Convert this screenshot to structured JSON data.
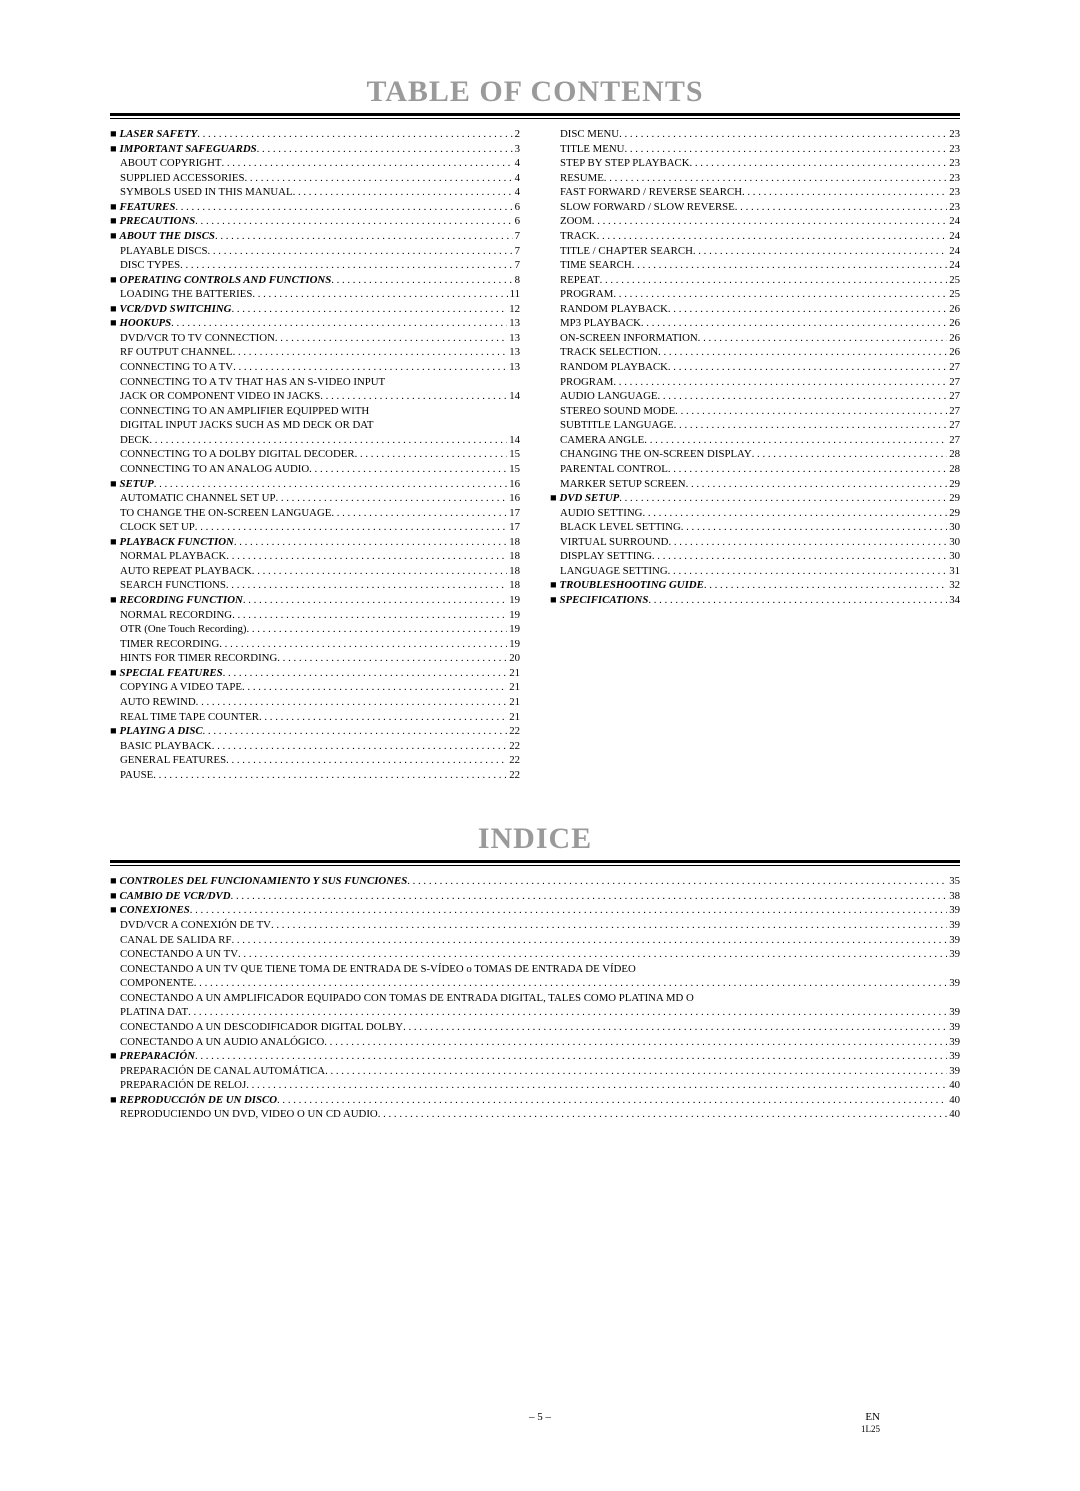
{
  "headings": {
    "toc": "TABLE OF CONTENTS",
    "indice": "INDICE"
  },
  "footer": {
    "page": "– 5 –",
    "lang": "EN",
    "code": "1L25"
  },
  "toc_left": [
    {
      "label": "LASER SAFETY",
      "page": "2",
      "bold": true,
      "indent": false
    },
    {
      "label": "IMPORTANT SAFEGUARDS",
      "page": "3",
      "bold": true,
      "indent": false
    },
    {
      "label": "ABOUT COPYRIGHT",
      "page": "4",
      "bold": false,
      "indent": true
    },
    {
      "label": "SUPPLIED ACCESSORIES",
      "page": "4",
      "bold": false,
      "indent": true
    },
    {
      "label": "SYMBOLS USED IN THIS MANUAL",
      "page": "4",
      "bold": false,
      "indent": true
    },
    {
      "label": "FEATURES",
      "page": "6",
      "bold": true,
      "indent": false
    },
    {
      "label": "PRECAUTIONS",
      "page": "6",
      "bold": true,
      "indent": false
    },
    {
      "label": "ABOUT THE DISCS",
      "page": "7",
      "bold": true,
      "indent": false
    },
    {
      "label": "PLAYABLE DISCS",
      "page": "7",
      "bold": false,
      "indent": true
    },
    {
      "label": "DISC TYPES",
      "page": "7",
      "bold": false,
      "indent": true
    },
    {
      "label": "OPERATING CONTROLS AND FUNCTIONS",
      "page": "8",
      "bold": true,
      "indent": false
    },
    {
      "label": "LOADING THE BATTERIES",
      "page": "11",
      "bold": false,
      "indent": true
    },
    {
      "label": "VCR/DVD SWITCHING",
      "page": "12",
      "bold": true,
      "indent": false
    },
    {
      "label": "HOOKUPS",
      "page": "13",
      "bold": true,
      "indent": false
    },
    {
      "label": "DVD/VCR TO TV CONNECTION",
      "page": "13",
      "bold": false,
      "indent": true
    },
    {
      "label": "RF OUTPUT CHANNEL",
      "page": "13",
      "bold": false,
      "indent": true
    },
    {
      "label": "CONNECTING TO A TV",
      "page": "13",
      "bold": false,
      "indent": true
    },
    {
      "label": "CONNECTING TO A TV THAT HAS AN S-VIDEO INPUT",
      "page": "",
      "bold": false,
      "indent": true,
      "nopage": true
    },
    {
      "label": "JACK OR COMPONENT VIDEO IN JACKS",
      "page": "14",
      "bold": false,
      "indent": true
    },
    {
      "label": "CONNECTING TO AN AMPLIFIER EQUIPPED WITH",
      "page": "",
      "bold": false,
      "indent": true,
      "nopage": true
    },
    {
      "label": "DIGITAL INPUT JACKS SUCH AS MD DECK OR DAT",
      "page": "",
      "bold": false,
      "indent": true,
      "nopage": true
    },
    {
      "label": "DECK",
      "page": "14",
      "bold": false,
      "indent": true
    },
    {
      "label": "CONNECTING TO A DOLBY DIGITAL DECODER",
      "page": "15",
      "bold": false,
      "indent": true
    },
    {
      "label": "CONNECTING TO AN ANALOG AUDIO",
      "page": "15",
      "bold": false,
      "indent": true
    },
    {
      "label": "SETUP",
      "page": "16",
      "bold": true,
      "indent": false
    },
    {
      "label": "AUTOMATIC CHANNEL SET UP",
      "page": "16",
      "bold": false,
      "indent": true
    },
    {
      "label": "TO CHANGE THE ON-SCREEN LANGUAGE",
      "page": "17",
      "bold": false,
      "indent": true
    },
    {
      "label": "CLOCK SET UP",
      "page": "17",
      "bold": false,
      "indent": true
    },
    {
      "label": "PLAYBACK FUNCTION",
      "page": "18",
      "bold": true,
      "indent": false
    },
    {
      "label": "NORMAL PLAYBACK",
      "page": "18",
      "bold": false,
      "indent": true
    },
    {
      "label": "AUTO REPEAT PLAYBACK",
      "page": "18",
      "bold": false,
      "indent": true
    },
    {
      "label": "SEARCH FUNCTIONS",
      "page": "18",
      "bold": false,
      "indent": true
    },
    {
      "label": "RECORDING FUNCTION",
      "page": "19",
      "bold": true,
      "indent": false
    },
    {
      "label": "NORMAL RECORDING",
      "page": "19",
      "bold": false,
      "indent": true
    },
    {
      "label": "OTR (One Touch Recording)",
      "page": "19",
      "bold": false,
      "indent": true
    },
    {
      "label": "TIMER RECORDING",
      "page": "19",
      "bold": false,
      "indent": true
    },
    {
      "label": "HINTS FOR TIMER RECORDING",
      "page": "20",
      "bold": false,
      "indent": true
    },
    {
      "label": "SPECIAL FEATURES",
      "page": "21",
      "bold": true,
      "indent": false
    },
    {
      "label": "COPYING A VIDEO TAPE",
      "page": "21",
      "bold": false,
      "indent": true
    },
    {
      "label": "AUTO REWIND",
      "page": "21",
      "bold": false,
      "indent": true
    },
    {
      "label": "REAL TIME TAPE COUNTER",
      "page": "21",
      "bold": false,
      "indent": true
    },
    {
      "label": "PLAYING A DISC",
      "page": "22",
      "bold": true,
      "indent": false
    },
    {
      "label": "BASIC PLAYBACK",
      "page": "22",
      "bold": false,
      "indent": true
    },
    {
      "label": "GENERAL FEATURES",
      "page": "22",
      "bold": false,
      "indent": true
    },
    {
      "label": "PAUSE",
      "page": "22",
      "bold": false,
      "indent": true
    }
  ],
  "toc_right": [
    {
      "label": "DISC MENU",
      "page": "23",
      "bold": false,
      "indent": true
    },
    {
      "label": "TITLE MENU",
      "page": "23",
      "bold": false,
      "indent": true
    },
    {
      "label": "STEP BY STEP PLAYBACK",
      "page": "23",
      "bold": false,
      "indent": true
    },
    {
      "label": "RESUME",
      "page": "23",
      "bold": false,
      "indent": true
    },
    {
      "label": "FAST FORWARD / REVERSE SEARCH",
      "page": "23",
      "bold": false,
      "indent": true
    },
    {
      "label": "SLOW FORWARD / SLOW REVERSE",
      "page": "23",
      "bold": false,
      "indent": true
    },
    {
      "label": "ZOOM",
      "page": "24",
      "bold": false,
      "indent": true
    },
    {
      "label": "TRACK",
      "page": "24",
      "bold": false,
      "indent": true
    },
    {
      "label": "TITLE / CHAPTER SEARCH",
      "page": "24",
      "bold": false,
      "indent": true
    },
    {
      "label": "TIME SEARCH",
      "page": "24",
      "bold": false,
      "indent": true
    },
    {
      "label": "REPEAT",
      "page": "25",
      "bold": false,
      "indent": true
    },
    {
      "label": "PROGRAM",
      "page": "25",
      "bold": false,
      "indent": true
    },
    {
      "label": "RANDOM PLAYBACK",
      "page": "26",
      "bold": false,
      "indent": true
    },
    {
      "label": "MP3 PLAYBACK",
      "page": "26",
      "bold": false,
      "indent": true
    },
    {
      "label": "ON-SCREEN INFORMATION",
      "page": "26",
      "bold": false,
      "indent": true
    },
    {
      "label": "TRACK SELECTION",
      "page": "26",
      "bold": false,
      "indent": true
    },
    {
      "label": "RANDOM PLAYBACK",
      "page": "27",
      "bold": false,
      "indent": true
    },
    {
      "label": "PROGRAM",
      "page": "27",
      "bold": false,
      "indent": true
    },
    {
      "label": "AUDIO LANGUAGE",
      "page": "27",
      "bold": false,
      "indent": true
    },
    {
      "label": "STEREO SOUND MODE",
      "page": "27",
      "bold": false,
      "indent": true
    },
    {
      "label": "SUBTITLE LANGUAGE",
      "page": "27",
      "bold": false,
      "indent": true
    },
    {
      "label": "CAMERA ANGLE",
      "page": "27",
      "bold": false,
      "indent": true
    },
    {
      "label": "CHANGING THE ON-SCREEN DISPLAY",
      "page": "28",
      "bold": false,
      "indent": true
    },
    {
      "label": "PARENTAL CONTROL",
      "page": "28",
      "bold": false,
      "indent": true
    },
    {
      "label": "MARKER SETUP SCREEN",
      "page": "29",
      "bold": false,
      "indent": true
    },
    {
      "label": "DVD SETUP",
      "page": "29",
      "bold": true,
      "indent": false
    },
    {
      "label": "AUDIO SETTING",
      "page": "29",
      "bold": false,
      "indent": true
    },
    {
      "label": "BLACK LEVEL SETTING",
      "page": "30",
      "bold": false,
      "indent": true
    },
    {
      "label": "VIRTUAL SURROUND",
      "page": "30",
      "bold": false,
      "indent": true
    },
    {
      "label": "DISPLAY SETTING",
      "page": "30",
      "bold": false,
      "indent": true
    },
    {
      "label": "LANGUAGE SETTING",
      "page": "31",
      "bold": false,
      "indent": true
    },
    {
      "label": "TROUBLESHOOTING GUIDE",
      "page": "32",
      "bold": true,
      "indent": false
    },
    {
      "label": "SPECIFICATIONS",
      "page": "34",
      "bold": true,
      "indent": false
    }
  ],
  "indice": [
    {
      "label": "CONTROLES DEL FUNCIONAMIENTO Y SUS FUNCIONES",
      "page": "35",
      "bold": true,
      "indent": false
    },
    {
      "label": "CAMBIO DE VCR/DVD",
      "page": "38",
      "bold": true,
      "indent": false
    },
    {
      "label": "CONEXIONES",
      "page": "39",
      "bold": true,
      "indent": false
    },
    {
      "label": "DVD/VCR A CONEXIÓN DE TV",
      "page": "39",
      "bold": false,
      "indent": true
    },
    {
      "label": "CANAL DE SALIDA RF",
      "page": "39",
      "bold": false,
      "indent": true
    },
    {
      "label": "CONECTANDO A UN TV",
      "page": "39",
      "bold": false,
      "indent": true
    },
    {
      "label": "CONECTANDO A UN TV QUE TIENE TOMA DE ENTRADA DE S-VÍDEO o TOMAS DE ENTRADA DE VÍDEO",
      "page": "",
      "bold": false,
      "indent": true,
      "nopage": true
    },
    {
      "label": "COMPONENTE",
      "page": "39",
      "bold": false,
      "indent": true
    },
    {
      "label": "CONECTANDO A UN AMPLIFICADOR EQUIPADO CON TOMAS DE ENTRADA DIGITAL, TALES COMO PLATINA MD O",
      "page": "",
      "bold": false,
      "indent": true,
      "nopage": true
    },
    {
      "label": "PLATINA DAT",
      "page": "39",
      "bold": false,
      "indent": true
    },
    {
      "label": "CONECTANDO A UN DESCODIFICADOR DIGITAL DOLBY",
      "page": "39",
      "bold": false,
      "indent": true
    },
    {
      "label": "CONECTANDO A UN AUDIO ANALÓGICO",
      "page": "39",
      "bold": false,
      "indent": true
    },
    {
      "label": "PREPARACIÓN",
      "page": "39",
      "bold": true,
      "indent": false
    },
    {
      "label": "PREPARACIÓN DE CANAL AUTOMÁTICA",
      "page": "39",
      "bold": false,
      "indent": true
    },
    {
      "label": "PREPARACIÓN DE RELOJ",
      "page": "40",
      "bold": false,
      "indent": true
    },
    {
      "label": "REPRODUCCIÓN DE UN DISCO",
      "page": "40",
      "bold": true,
      "indent": false
    },
    {
      "label": "REPRODUCIENDO UN DVD, VIDEO O UN CD AUDIO",
      "page": "40",
      "bold": false,
      "indent": true
    }
  ]
}
